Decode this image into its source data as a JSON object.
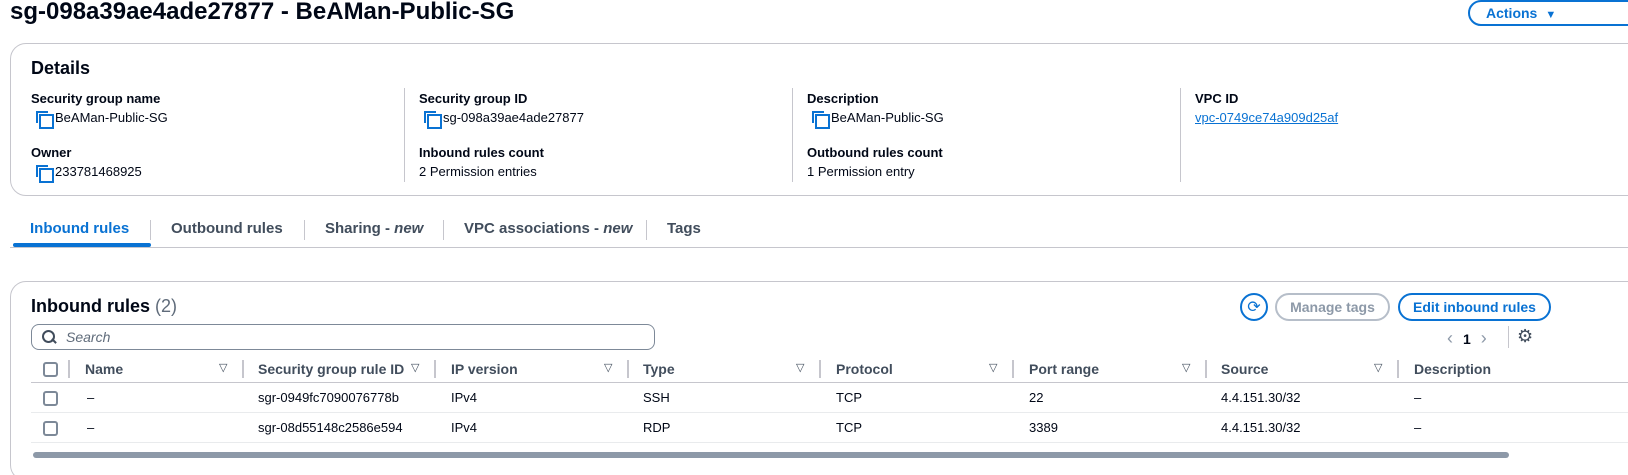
{
  "page": {
    "title": "sg-098a39ae4ade27877 - BeAMan-Public-SG",
    "actions_label": "Actions"
  },
  "details": {
    "heading": "Details",
    "security_group_name": {
      "label": "Security group name",
      "value": "BeAMan-Public-SG"
    },
    "security_group_id": {
      "label": "Security group ID",
      "value": "sg-098a39ae4ade27877"
    },
    "description": {
      "label": "Description",
      "value": "BeAMan-Public-SG"
    },
    "vpc_id": {
      "label": "VPC ID",
      "value": "vpc-0749ce74a909d25af"
    },
    "owner": {
      "label": "Owner",
      "value": "233781468925"
    },
    "inbound_rules_count": {
      "label": "Inbound rules count",
      "value": "2 Permission entries"
    },
    "outbound_rules_count": {
      "label": "Outbound rules count",
      "value": "1 Permission entry"
    }
  },
  "tabs": {
    "inbound": "Inbound rules",
    "outbound": "Outbound rules",
    "sharing": "Sharing - ",
    "sharing_badge": "new",
    "vpc_associations": "VPC associations - ",
    "vpc_associations_badge": "new",
    "tags": "Tags"
  },
  "inbound_rules": {
    "heading": "Inbound rules",
    "count": "(2)",
    "manage_tags_label": "Manage tags",
    "edit_label": "Edit inbound rules",
    "search_placeholder": "Search",
    "page_number": "1",
    "columns": [
      "Name",
      "Security group rule ID",
      "IP version",
      "Type",
      "Protocol",
      "Port range",
      "Source",
      "Description"
    ],
    "rows": [
      {
        "name": "–",
        "rule_id": "sgr-0949fc7090076778b",
        "ip_version": "IPv4",
        "type": "SSH",
        "protocol": "TCP",
        "port_range": "22",
        "source": "4.4.151.30/32",
        "description": "–"
      },
      {
        "name": "–",
        "rule_id": "sgr-08d55148c2586e594",
        "ip_version": "IPv4",
        "type": "RDP",
        "protocol": "TCP",
        "port_range": "3389",
        "source": "4.4.151.30/32",
        "description": "–"
      }
    ]
  },
  "colors": {
    "accent": "#0972d3",
    "border": "#c6c6cd",
    "text": "#000716"
  }
}
